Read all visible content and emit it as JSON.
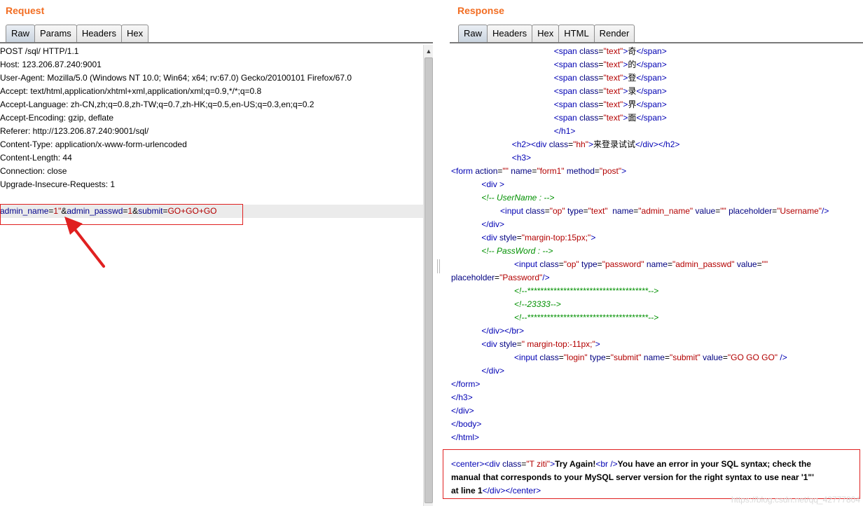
{
  "request": {
    "title": "Request",
    "tabs": [
      {
        "label": "Raw",
        "active": true
      },
      {
        "label": "Params",
        "active": false
      },
      {
        "label": "Headers",
        "active": false
      },
      {
        "label": "Hex",
        "active": false
      }
    ],
    "lines": [
      "POST /sql/ HTTP/1.1",
      "Host: 123.206.87.240:9001",
      "User-Agent: Mozilla/5.0 (Windows NT 10.0; Win64; x64; rv:67.0) Gecko/20100101 Firefox/67.0",
      "Accept: text/html,application/xhtml+xml,application/xml;q=0.9,*/*;q=0.8",
      "Accept-Language: zh-CN,zh;q=0.8,zh-TW;q=0.7,zh-HK;q=0.5,en-US;q=0.3,en;q=0.2",
      "Accept-Encoding: gzip, deflate",
      "Referer: http://123.206.87.240:9001/sql/",
      "Content-Type: application/x-www-form-urlencoded",
      "Content-Length: 44",
      "Connection: close",
      "Upgrade-Insecure-Requests: 1"
    ],
    "body": {
      "k1": "admin_name",
      "eq1": "=",
      "v1": "1\"",
      "amp1": "&",
      "k2": "admin_passwd",
      "eq2": "=",
      "v2": "1",
      "amp2": "&",
      "k3": "submit",
      "eq3": "=",
      "v3": "GO+GO+GO"
    },
    "scroll_up": "▲"
  },
  "response": {
    "title": "Response",
    "tabs": [
      {
        "label": "Raw",
        "active": true
      },
      {
        "label": "Headers",
        "active": false
      },
      {
        "label": "Hex",
        "active": false
      },
      {
        "label": "HTML",
        "active": false
      },
      {
        "label": "Render",
        "active": false
      }
    ],
    "spans": [
      "奇",
      "的",
      "登",
      "录",
      "界",
      "面"
    ],
    "h2_text": "来登录试试",
    "username_comment": "<!-- UserName : -->",
    "password_comment": "<!-- PassWord : -->",
    "stars_comment": "<!--*************************************-->",
    "c23333": "<!--23333-->",
    "error_bold_1": "Try Again!",
    "error_bold_2": "You have an error in your SQL syntax; check the",
    "error_bold_3": "manual that corresponds to your MySQL server version for the right syntax to use near '1\"'",
    "error_bold_4": "at line 1"
  },
  "watermark": "https://blog.csdn.net/qq_42777804",
  "colors": {
    "title_orange": "#f26d22",
    "highlight_red": "#e02020",
    "tag_blue": "#0000b4",
    "value_red": "#b30000",
    "comment_green": "#009000"
  }
}
